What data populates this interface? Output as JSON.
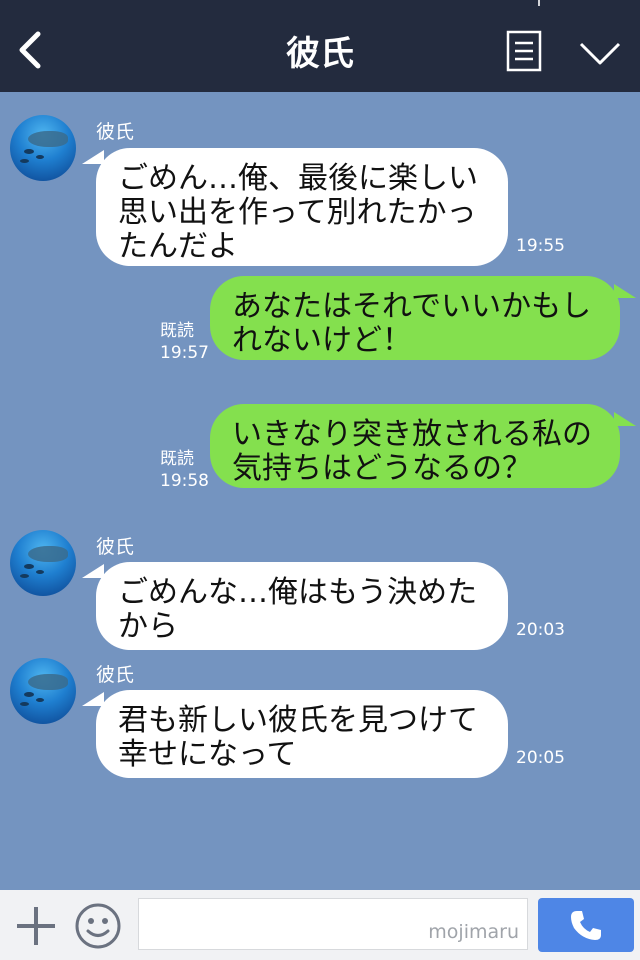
{
  "header": {
    "title": "彼氏",
    "back_icon": "back-chevron-icon",
    "notes_icon": "notes-icon",
    "menu_icon": "chevron-down-icon",
    "background": "#232b3e"
  },
  "chat": {
    "background": "#7494c0",
    "messages": [
      {
        "direction": "in",
        "sender": "彼氏",
        "lines": [
          "ごめん…俺、最後に楽しい",
          "思い出を作って別れたかっ",
          "たんだよ"
        ],
        "time": "19:55"
      },
      {
        "direction": "out",
        "lines": [
          "あなたはそれでいいかもし",
          "れないけど！"
        ],
        "read": "既読",
        "time": "19:57"
      },
      {
        "direction": "out",
        "lines": [
          "いきなり突き放される私の",
          "気持ちはどうなるの？"
        ],
        "read": "既読",
        "time": "19:58"
      },
      {
        "direction": "in",
        "sender": "彼氏",
        "lines": [
          "ごめんな…俺はもう決めた",
          "から"
        ],
        "time": "20:03"
      },
      {
        "direction": "in",
        "sender": "彼氏",
        "lines": [
          "君も新しい彼氏を見つけて",
          "幸せになって"
        ],
        "time": "20:05"
      }
    ]
  },
  "colors": {
    "incoming_bubble": "#ffffff",
    "outgoing_bubble": "#84e04e",
    "call_button": "#4e86e6"
  },
  "footer": {
    "plus_icon": "plus-icon",
    "emoji_icon": "smiley-icon",
    "input_watermark": "mojimaru",
    "call_icon": "phone-icon"
  }
}
